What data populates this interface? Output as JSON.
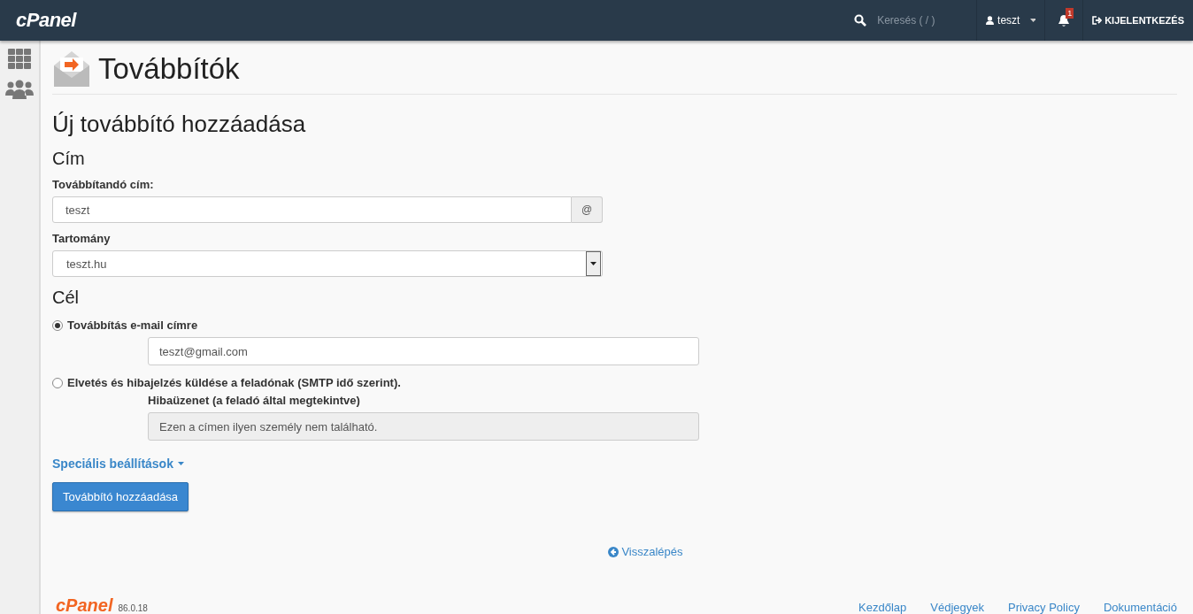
{
  "header": {
    "logo": "cPanel",
    "search": {
      "placeholder": "Keresés ( / )"
    },
    "user": "teszt",
    "notifications": "1",
    "logout": "KIJELENTKEZÉS"
  },
  "page": {
    "title": "Továbbítók"
  },
  "form": {
    "heading": "Új továbbító hozzáadása",
    "address_section": "Cím",
    "address_label": "Továbbítandó cím:",
    "address_value": "teszt",
    "address_addon": "@",
    "domain_label": "Tartomány",
    "domain_value": "teszt.hu",
    "destination_section": "Cél",
    "destinations": [
      {
        "kind": "forward",
        "label": "Továbbítás e-mail címre",
        "selected": true,
        "value": "teszt@gmail.com"
      },
      {
        "kind": "fail",
        "label": "Elvetés és hibajelzés küldése a feladónak (SMTP idő szerint).",
        "selected": false,
        "sublabel": "Hibaüzenet (a feladó által megtekintve)",
        "value": "Ezen a címen ilyen személy nem található."
      }
    ],
    "advanced": "Speciális beállítások",
    "submit": "Továbbító hozzáadása"
  },
  "back_link": "Visszalépés",
  "footer": {
    "logo": "cPanel",
    "version": "86.0.18",
    "links": [
      "Kezdőlap",
      "Védjegyek",
      "Privacy Policy",
      "Dokumentáció"
    ]
  }
}
